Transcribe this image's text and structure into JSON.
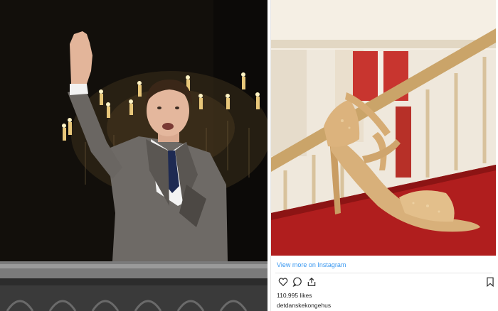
{
  "left_photo": {
    "subject": "Man in grey suit waving from balcony with chandelier behind"
  },
  "embed": {
    "photo_subject": "Gold high-heel sandal on red carpet staircase",
    "view_more_label": "View more on Instagram",
    "likes_label": "110,995 likes",
    "username": "detdanskekongehus",
    "icons": [
      "heart-icon",
      "comment-icon",
      "share-icon",
      "bookmark-icon"
    ],
    "link_color": "#3897f0"
  }
}
